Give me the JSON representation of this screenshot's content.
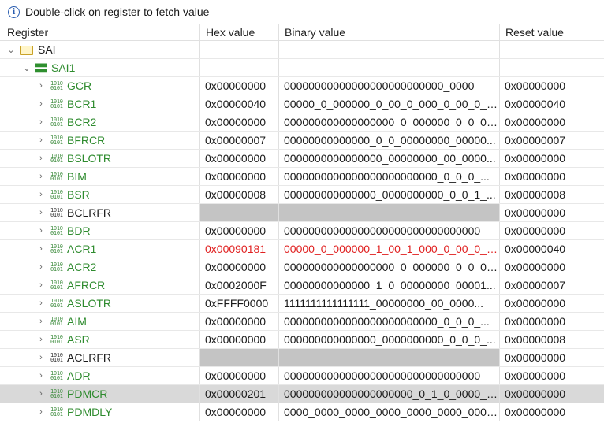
{
  "info": {
    "text": "Double-click on register to fetch value"
  },
  "columns": [
    "Register",
    "Hex value",
    "Binary value",
    "Reset value"
  ],
  "tree": [
    {
      "name": "SAI",
      "level": 0,
      "kind": "group"
    },
    {
      "name": "SAI1",
      "level": 1,
      "kind": "peripheral"
    }
  ],
  "registers": [
    {
      "name": "GCR",
      "hex": "0x00000000",
      "bin": "00000000000000000000000000_0000",
      "reset": "0x00000000",
      "state": "normal"
    },
    {
      "name": "BCR1",
      "hex": "0x00000040",
      "bin": "00000_0_000000_0_00_0_000_0_00_0_0_...",
      "reset": "0x00000040",
      "state": "normal"
    },
    {
      "name": "BCR2",
      "hex": "0x00000000",
      "bin": "000000000000000000_0_000000_0_0_0_...",
      "reset": "0x00000000",
      "state": "normal"
    },
    {
      "name": "BFRCR",
      "hex": "0x00000007",
      "bin": "00000000000000_0_0_00000000_00000...",
      "reset": "0x00000007",
      "state": "normal"
    },
    {
      "name": "BSLOTR",
      "hex": "0x00000000",
      "bin": "0000000000000000_00000000_00_0000...",
      "reset": "0x00000000",
      "state": "normal"
    },
    {
      "name": "BIM",
      "hex": "0x00000000",
      "bin": "0000000000000000000000000_0_0_0_...",
      "reset": "0x00000000",
      "state": "normal"
    },
    {
      "name": "BSR",
      "hex": "0x00000008",
      "bin": "000000000000000_0000000000_0_0_1_...",
      "reset": "0x00000008",
      "state": "normal"
    },
    {
      "name": "BCLRFR",
      "hex": "",
      "bin": "",
      "reset": "0x00000000",
      "state": "writeonly"
    },
    {
      "name": "BDR",
      "hex": "0x00000000",
      "bin": "00000000000000000000000000000000",
      "reset": "0x00000000",
      "state": "normal"
    },
    {
      "name": "ACR1",
      "hex": "0x00090181",
      "bin": "00000_0_000000_1_00_1_000_0_00_0_1_...",
      "reset": "0x00000040",
      "state": "changed"
    },
    {
      "name": "ACR2",
      "hex": "0x00000000",
      "bin": "000000000000000000_0_000000_0_0_0_...",
      "reset": "0x00000000",
      "state": "normal"
    },
    {
      "name": "AFRCR",
      "hex": "0x0002000F",
      "bin": "00000000000000_1_0_00000000_00001...",
      "reset": "0x00000007",
      "state": "normal"
    },
    {
      "name": "ASLOTR",
      "hex": "0xFFFF0000",
      "bin": "1111111111111111_00000000_00_0000...",
      "reset": "0x00000000",
      "state": "normal"
    },
    {
      "name": "AIM",
      "hex": "0x00000000",
      "bin": "0000000000000000000000000_0_0_0_...",
      "reset": "0x00000000",
      "state": "normal"
    },
    {
      "name": "ASR",
      "hex": "0x00000000",
      "bin": "000000000000000_0000000000_0_0_0_...",
      "reset": "0x00000008",
      "state": "normal"
    },
    {
      "name": "ACLRFR",
      "hex": "",
      "bin": "",
      "reset": "0x00000000",
      "state": "writeonly"
    },
    {
      "name": "ADR",
      "hex": "0x00000000",
      "bin": "00000000000000000000000000000000",
      "reset": "0x00000000",
      "state": "normal"
    },
    {
      "name": "PDMCR",
      "hex": "0x00000201",
      "bin": "000000000000000000000_0_1_0_0000_0...",
      "reset": "0x00000000",
      "state": "selected"
    },
    {
      "name": "PDMDLY",
      "hex": "0x00000000",
      "bin": "0000_0000_0000_0000_0000_0000_0000...",
      "reset": "0x00000000",
      "state": "normal"
    }
  ],
  "colors": {
    "accent_green": "#2e8b2e",
    "changed_red": "#e02020",
    "selected_row": "#d9d9d9",
    "writeonly_cell": "#c4c4c4"
  }
}
